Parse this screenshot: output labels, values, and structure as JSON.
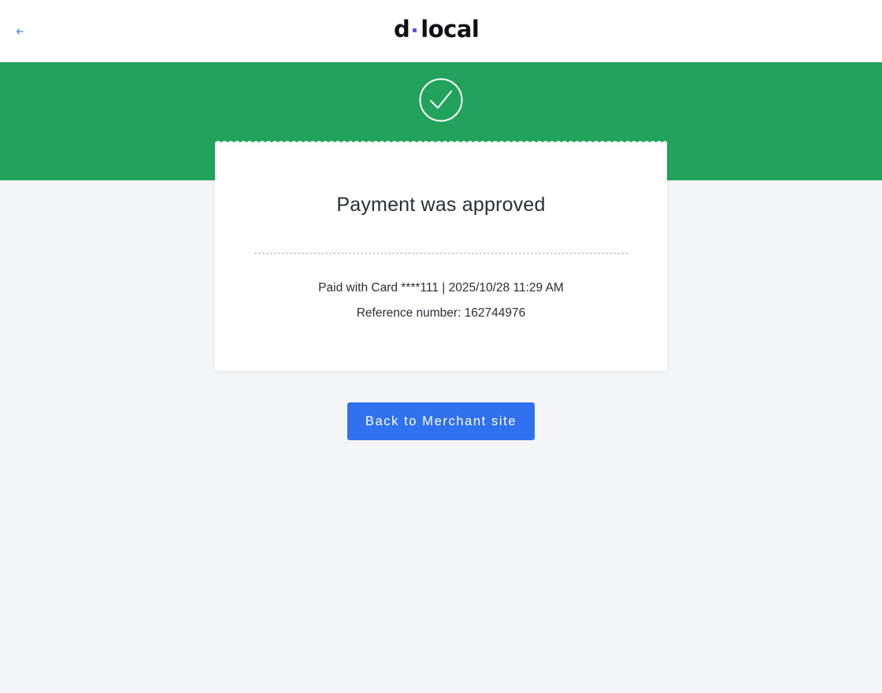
{
  "header": {
    "logo_left": "d",
    "logo_right": "local",
    "back_icon": "arrow-left-icon",
    "logo_dot_color": "#6b3ff5"
  },
  "banner": {
    "color": "#22a35c",
    "icon": "checkmark-circle-icon"
  },
  "receipt": {
    "title": "Payment was approved",
    "paid_with": "Paid with Card ****111 | 2025/10/28 11:29 AM",
    "reference": "Reference number: 162744976"
  },
  "actions": {
    "back_to_merchant_label": "Back to Merchant site",
    "button_color": "#3071f0"
  }
}
